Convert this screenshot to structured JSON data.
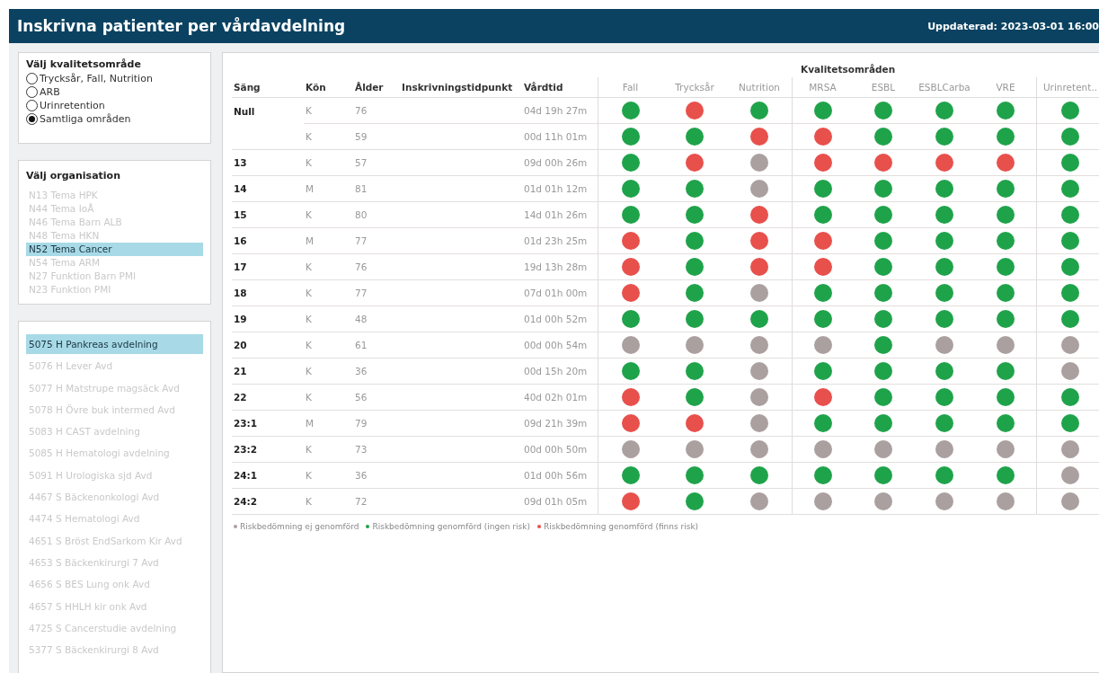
{
  "header": {
    "title": "Inskrivna patienter per vårdavdelning",
    "updated": "Uppdaterad: 2023-03-01 16:00"
  },
  "quality_filter": {
    "title": "Välj kvalitetsområde",
    "options": [
      {
        "label": "Trycksår, Fall, Nutrition",
        "selected": false
      },
      {
        "label": "ARB",
        "selected": false
      },
      {
        "label": "Urinretention",
        "selected": false
      },
      {
        "label": "Samtliga områden",
        "selected": true
      }
    ]
  },
  "organisation_filter": {
    "title": "Välj organisation",
    "items": [
      {
        "label": "N13 Tema HPK",
        "selected": false
      },
      {
        "label": "N44 Tema IoÅ",
        "selected": false
      },
      {
        "label": "N46 Tema Barn ALB",
        "selected": false
      },
      {
        "label": "N48 Tema HKN",
        "selected": false
      },
      {
        "label": "N52 Tema Cancer",
        "selected": true
      },
      {
        "label": "N54 Tema ARM",
        "selected": false
      },
      {
        "label": "N27 Funktion Barn PMI",
        "selected": false
      },
      {
        "label": "N23 Funktion PMI",
        "selected": false
      }
    ]
  },
  "department_filter": {
    "items": [
      {
        "label": "5075 H Pankreas avdelning",
        "selected": true
      },
      {
        "label": "5076 H Lever Avd",
        "selected": false
      },
      {
        "label": "5077 H Matstrupe magsäck Avd",
        "selected": false
      },
      {
        "label": "5078 H Övre buk intermed Avd",
        "selected": false
      },
      {
        "label": "5083 H CAST avdelning",
        "selected": false
      },
      {
        "label": "5085 H Hematologi avdelning",
        "selected": false
      },
      {
        "label": "5091 H Urologiska sjd Avd",
        "selected": false
      },
      {
        "label": "4467 S Bäckenonkologi Avd",
        "selected": false
      },
      {
        "label": "4474 S Hematologi Avd",
        "selected": false
      },
      {
        "label": "4651 S Bröst EndSarkom Kir Avd",
        "selected": false
      },
      {
        "label": "4653 S Bäckenkirurgi 7 Avd",
        "selected": false
      },
      {
        "label": "4656 S BES Lung onk Avd",
        "selected": false
      },
      {
        "label": "4657 S HHLH kir onk Avd",
        "selected": false
      },
      {
        "label": "4725 S Cancerstudie avdelning",
        "selected": false
      },
      {
        "label": "5377 S Bäckenkirurgi 8 Avd",
        "selected": false
      }
    ]
  },
  "table": {
    "group_title": "Kvalitetsområden",
    "columns": [
      "Säng",
      "Kön",
      "Ålder",
      "Inskrivningstidpunkt",
      "Vårdtid"
    ],
    "area_columns": [
      "Fall",
      "Trycksår",
      "Nutrition",
      "MRSA",
      "ESBL",
      "ESBLCarba",
      "VRE",
      "Urinretent.."
    ],
    "rows": [
      {
        "bed": "Null",
        "sex": "K",
        "age": "76",
        "duration": "04d 19h 27m",
        "statuses": [
          {
            "color": "#1fa34a"
          },
          {
            "color": "#e8504c"
          },
          {
            "color": "#1fa34a"
          },
          {
            "color": "#1fa34a"
          },
          {
            "color": "#1fa34a"
          },
          {
            "color": "#1fa34a"
          },
          {
            "color": "#1fa34a"
          },
          {
            "color": "#1fa34a"
          }
        ]
      },
      {
        "sex": "K",
        "age": "59",
        "duration": "00d 11h 01m",
        "statuses": [
          {
            "color": "#1fa34a"
          },
          {
            "color": "#1fa34a"
          },
          {
            "color": "#e8504c"
          },
          {
            "color": "#e8504c"
          },
          {
            "color": "#1fa34a"
          },
          {
            "color": "#1fa34a"
          },
          {
            "color": "#1fa34a"
          },
          {
            "color": "#1fa34a"
          }
        ]
      },
      {
        "bed": "13",
        "sex": "K",
        "age": "57",
        "duration": "09d 00h 26m",
        "statuses": [
          {
            "color": "#1fa34a"
          },
          {
            "color": "#e8504c"
          },
          {
            "color": "#aaa09f"
          },
          {
            "color": "#e8504c"
          },
          {
            "color": "#e8504c"
          },
          {
            "color": "#e8504c"
          },
          {
            "color": "#e8504c"
          },
          {
            "color": "#1fa34a"
          }
        ]
      },
      {
        "bed": "14",
        "sex": "M",
        "age": "81",
        "duration": "01d 01h 12m",
        "statuses": [
          {
            "color": "#1fa34a"
          },
          {
            "color": "#1fa34a"
          },
          {
            "color": "#aaa09f"
          },
          {
            "color": "#1fa34a"
          },
          {
            "color": "#1fa34a"
          },
          {
            "color": "#1fa34a"
          },
          {
            "color": "#1fa34a"
          },
          {
            "color": "#1fa34a"
          }
        ]
      },
      {
        "bed": "15",
        "sex": "K",
        "age": "80",
        "duration": "14d 01h 26m",
        "statuses": [
          {
            "color": "#1fa34a"
          },
          {
            "color": "#1fa34a"
          },
          {
            "color": "#e8504c"
          },
          {
            "color": "#1fa34a"
          },
          {
            "color": "#1fa34a"
          },
          {
            "color": "#1fa34a"
          },
          {
            "color": "#1fa34a"
          },
          {
            "color": "#1fa34a"
          }
        ]
      },
      {
        "bed": "16",
        "sex": "M",
        "age": "77",
        "duration": "01d 23h 25m",
        "statuses": [
          {
            "color": "#e8504c"
          },
          {
            "color": "#1fa34a"
          },
          {
            "color": "#e8504c"
          },
          {
            "color": "#e8504c"
          },
          {
            "color": "#1fa34a"
          },
          {
            "color": "#1fa34a"
          },
          {
            "color": "#1fa34a"
          },
          {
            "color": "#1fa34a"
          }
        ]
      },
      {
        "bed": "17",
        "sex": "K",
        "age": "76",
        "duration": "19d 13h 28m",
        "statuses": [
          {
            "color": "#e8504c"
          },
          {
            "color": "#1fa34a"
          },
          {
            "color": "#e8504c"
          },
          {
            "color": "#e8504c"
          },
          {
            "color": "#1fa34a"
          },
          {
            "color": "#1fa34a"
          },
          {
            "color": "#1fa34a"
          },
          {
            "color": "#1fa34a"
          }
        ]
      },
      {
        "bed": "18",
        "sex": "K",
        "age": "77",
        "duration": "07d 01h 00m",
        "statuses": [
          {
            "color": "#e8504c"
          },
          {
            "color": "#1fa34a"
          },
          {
            "color": "#aaa09f"
          },
          {
            "color": "#1fa34a"
          },
          {
            "color": "#1fa34a"
          },
          {
            "color": "#1fa34a"
          },
          {
            "color": "#1fa34a"
          },
          {
            "color": "#1fa34a"
          }
        ]
      },
      {
        "bed": "19",
        "sex": "K",
        "age": "48",
        "duration": "01d 00h 52m",
        "statuses": [
          {
            "color": "#1fa34a"
          },
          {
            "color": "#1fa34a"
          },
          {
            "color": "#1fa34a"
          },
          {
            "color": "#1fa34a"
          },
          {
            "color": "#1fa34a"
          },
          {
            "color": "#1fa34a"
          },
          {
            "color": "#1fa34a"
          },
          {
            "color": "#1fa34a"
          }
        ]
      },
      {
        "bed": "20",
        "sex": "K",
        "age": "61",
        "duration": "00d 00h 54m",
        "statuses": [
          {
            "color": "#aaa09f"
          },
          {
            "color": "#aaa09f"
          },
          {
            "color": "#aaa09f"
          },
          {
            "color": "#aaa09f"
          },
          {
            "color": "#1fa34a"
          },
          {
            "color": "#aaa09f"
          },
          {
            "color": "#aaa09f"
          },
          {
            "color": "#aaa09f"
          }
        ]
      },
      {
        "bed": "21",
        "sex": "K",
        "age": "36",
        "duration": "00d 15h 20m",
        "statuses": [
          {
            "color": "#1fa34a"
          },
          {
            "color": "#1fa34a"
          },
          {
            "color": "#aaa09f"
          },
          {
            "color": "#1fa34a"
          },
          {
            "color": "#1fa34a"
          },
          {
            "color": "#1fa34a"
          },
          {
            "color": "#1fa34a"
          },
          {
            "color": "#aaa09f"
          }
        ]
      },
      {
        "bed": "22",
        "sex": "K",
        "age": "56",
        "duration": "40d 02h 01m",
        "statuses": [
          {
            "color": "#e8504c"
          },
          {
            "color": "#1fa34a"
          },
          {
            "color": "#aaa09f"
          },
          {
            "color": "#e8504c"
          },
          {
            "color": "#1fa34a"
          },
          {
            "color": "#1fa34a"
          },
          {
            "color": "#1fa34a"
          },
          {
            "color": "#1fa34a"
          }
        ]
      },
      {
        "bed": "23:1",
        "sex": "M",
        "age": "79",
        "duration": "09d 21h 39m",
        "statuses": [
          {
            "color": "#e8504c"
          },
          {
            "color": "#e8504c"
          },
          {
            "color": "#aaa09f"
          },
          {
            "color": "#1fa34a"
          },
          {
            "color": "#1fa34a"
          },
          {
            "color": "#1fa34a"
          },
          {
            "color": "#1fa34a"
          },
          {
            "color": "#1fa34a"
          }
        ]
      },
      {
        "bed": "23:2",
        "sex": "K",
        "age": "73",
        "duration": "00d 00h 50m",
        "statuses": [
          {
            "color": "#aaa09f"
          },
          {
            "color": "#aaa09f"
          },
          {
            "color": "#aaa09f"
          },
          {
            "color": "#aaa09f"
          },
          {
            "color": "#aaa09f"
          },
          {
            "color": "#aaa09f"
          },
          {
            "color": "#aaa09f"
          },
          {
            "color": "#aaa09f"
          }
        ]
      },
      {
        "bed": "24:1",
        "sex": "K",
        "age": "36",
        "duration": "01d 00h 56m",
        "statuses": [
          {
            "color": "#1fa34a"
          },
          {
            "color": "#1fa34a"
          },
          {
            "color": "#1fa34a"
          },
          {
            "color": "#1fa34a"
          },
          {
            "color": "#1fa34a"
          },
          {
            "color": "#1fa34a"
          },
          {
            "color": "#1fa34a"
          },
          {
            "color": "#aaa09f"
          }
        ]
      },
      {
        "bed": "24:2",
        "sex": "K",
        "age": "72",
        "duration": "09d 01h 05m",
        "statuses": [
          {
            "color": "#e8504c"
          },
          {
            "color": "#1fa34a"
          },
          {
            "color": "#aaa09f"
          },
          {
            "color": "#aaa09f"
          },
          {
            "color": "#aaa09f"
          },
          {
            "color": "#aaa09f"
          },
          {
            "color": "#aaa09f"
          },
          {
            "color": "#aaa09f"
          }
        ]
      }
    ]
  },
  "legend": [
    {
      "label": "Riskbedömning ej genomförd",
      "color": "#aaa09f"
    },
    {
      "label": "Riskbedömning genomförd (ingen risk)",
      "color": "#1fa34a"
    },
    {
      "label": "Riskbedömning genomförd (finns risk)",
      "color": "#e8504c"
    }
  ]
}
